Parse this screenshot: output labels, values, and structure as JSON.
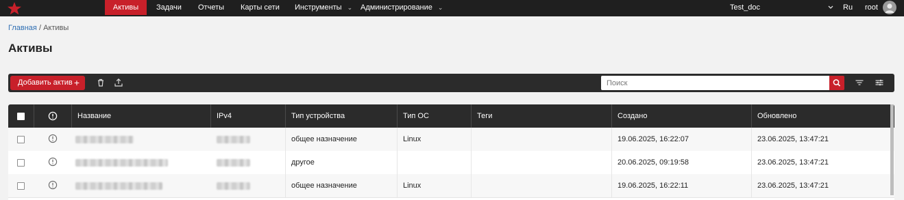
{
  "nav": {
    "items": [
      {
        "label": "Активы",
        "active": true,
        "has_caret": false
      },
      {
        "label": "Задачи",
        "active": false,
        "has_caret": false
      },
      {
        "label": "Отчеты",
        "active": false,
        "has_caret": false
      },
      {
        "label": "Карты сети",
        "active": false,
        "has_caret": false
      },
      {
        "label": "Инструменты",
        "active": false,
        "has_caret": true
      },
      {
        "label": "Администрирование",
        "active": false,
        "has_caret": true
      }
    ],
    "tenant": "Test_doc",
    "language": "Ru",
    "user": "root"
  },
  "breadcrumb": {
    "home": "Главная",
    "separator": "/",
    "current": "Активы"
  },
  "page_title": "Активы",
  "toolbar": {
    "add_label": "Добавить актив",
    "add_icon": "+",
    "delete_icon": "trash-icon",
    "export_icon": "upload-icon",
    "search_placeholder": "Поиск",
    "filter_icon": "filter-icon",
    "columns_icon": "settings-sliders-icon"
  },
  "table": {
    "columns": [
      "",
      "",
      "Название",
      "IPv4",
      "Тип устройства",
      "Тип ОС",
      "Теги",
      "Создано",
      "Обновлено"
    ],
    "rows": [
      {
        "device_type": "общее назначение",
        "os": "Linux",
        "tags": "",
        "created": "19.06.2025, 16:22:07",
        "updated": "23.06.2025, 13:47:21"
      },
      {
        "device_type": "другое",
        "os": "",
        "tags": "",
        "created": "20.06.2025, 09:19:58",
        "updated": "23.06.2025, 13:47:21"
      },
      {
        "device_type": "общее назначение",
        "os": "Linux",
        "tags": "",
        "created": "19.06.2025, 16:22:11",
        "updated": "23.06.2025, 13:47:21"
      }
    ]
  },
  "colors": {
    "accent": "#c8202a",
    "topbar": "#1f1f1f",
    "toolbar": "#2b2b2b",
    "link": "#2f6fb3"
  }
}
